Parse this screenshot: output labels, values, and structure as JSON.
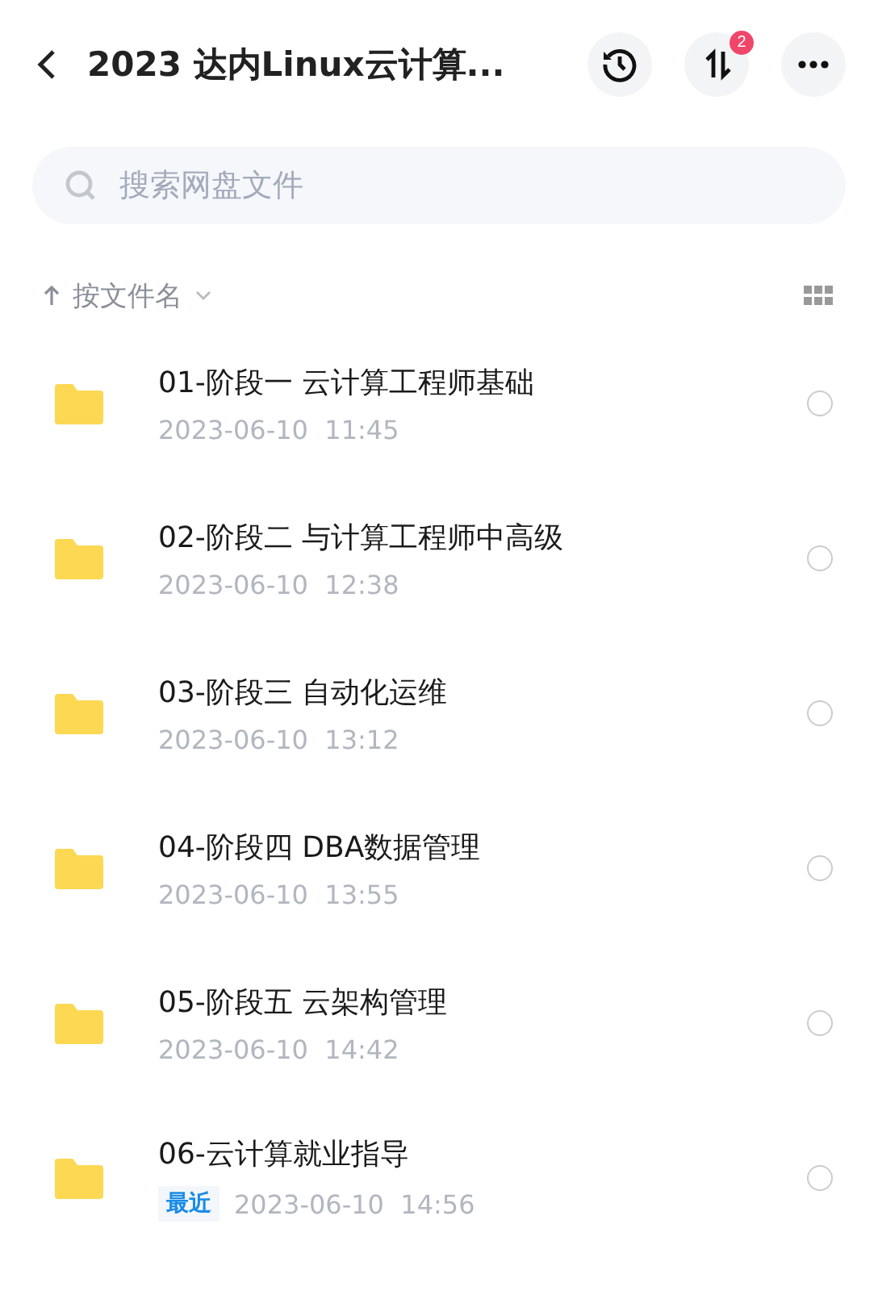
{
  "header": {
    "title": "2023 达内Linux云计算...",
    "transfer_badge": "2"
  },
  "search": {
    "placeholder": "搜索网盘文件"
  },
  "sort": {
    "label": "按文件名"
  },
  "files": [
    {
      "name": "01-阶段一 云计算工程师基础",
      "date": "2023-06-10  11:45",
      "selected": false
    },
    {
      "name": "02-阶段二 与计算工程师中高级",
      "date": "2023-06-10  12:38",
      "selected": false
    },
    {
      "name": "03-阶段三 自动化运维",
      "date": "2023-06-10  13:12",
      "selected": false
    },
    {
      "name": "04-阶段四 DBA数据管理",
      "date": "2023-06-10  13:55",
      "selected": false
    },
    {
      "name": "05-阶段五 云架构管理",
      "date": "2023-06-10  14:42",
      "selected": false
    },
    {
      "name": "06-云计算就业指导",
      "tag": "最近",
      "date": "2023-06-10  14:56",
      "selected": false
    }
  ]
}
